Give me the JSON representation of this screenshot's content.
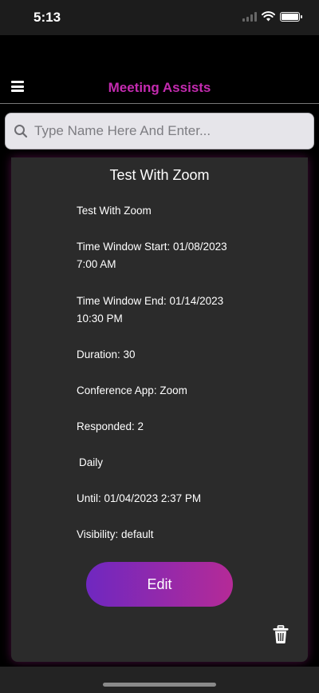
{
  "status_bar": {
    "time": "5:13",
    "icons": [
      "signal-icon",
      "wifi-icon",
      "battery-icon"
    ]
  },
  "header": {
    "title": "Meeting Assists",
    "title_color": "#c42bb0",
    "menu_icon": "hamburger-menu-icon"
  },
  "search": {
    "placeholder": "Type Name Here And Enter...",
    "value": "",
    "icon": "search-icon"
  },
  "card": {
    "title": "Test With Zoom",
    "summary": "Test With Zoom",
    "window_start_line1": "Time Window Start: 01/08/2023",
    "window_start_line2": "7:00 AM",
    "window_end_line1": "Time Window End: 01/14/2023",
    "window_end_line2": "10:30 PM",
    "duration": "Duration: 30",
    "conference_app": "Conference App: Zoom",
    "responded": "Responded: 2",
    "frequency": "Daily",
    "until": "Until: 01/04/2023 2:37 PM",
    "visibility": "Visibility: default",
    "edit_label": "Edit",
    "delete_icon": "trash-icon"
  },
  "colors": {
    "accent": "#c42bb0",
    "button_gradient_start": "#6f28c0",
    "button_gradient_end": "#b52a97",
    "card_background": "#2b2b2b"
  }
}
